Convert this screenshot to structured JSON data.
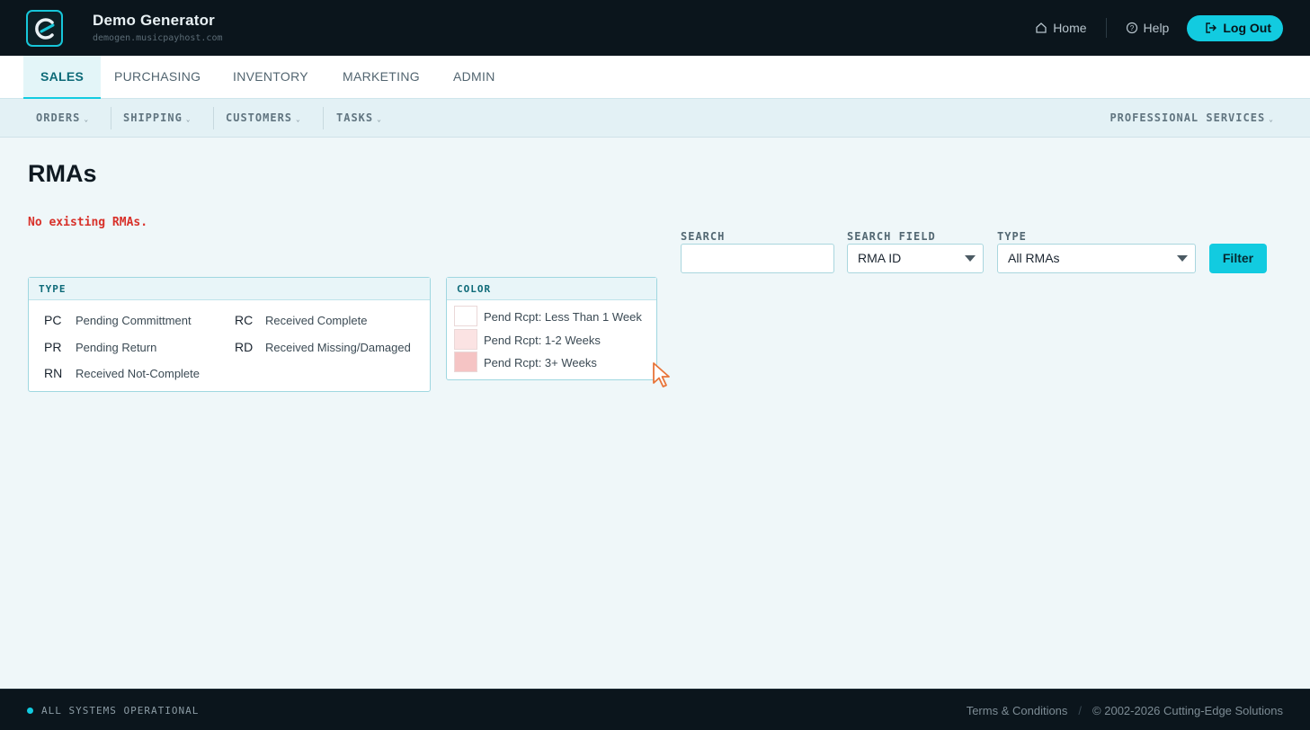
{
  "header": {
    "brand_title": "Demo Generator",
    "brand_subtitle": "demogen.musicpayhost.com",
    "home_label": "Home",
    "help_label": "Help",
    "logout_label": "Log Out"
  },
  "main_nav": {
    "tabs": [
      {
        "label": "SALES",
        "active": true
      },
      {
        "label": "PURCHASING",
        "active": false
      },
      {
        "label": "INVENTORY",
        "active": false
      },
      {
        "label": "MARKETING",
        "active": false
      },
      {
        "label": "ADMIN",
        "active": false
      }
    ]
  },
  "sub_nav": {
    "items": [
      {
        "label": "ORDERS"
      },
      {
        "label": "SHIPPING"
      },
      {
        "label": "CUSTOMERS"
      },
      {
        "label": "TASKS"
      }
    ],
    "right_item": {
      "label": "PROFESSIONAL SERVICES"
    }
  },
  "page": {
    "title": "RMAs",
    "notice": "No existing RMAs."
  },
  "type_legend": {
    "heading": "TYPE",
    "entries": [
      {
        "code": "PC",
        "label": "Pending Committment"
      },
      {
        "code": "RC",
        "label": "Received Complete"
      },
      {
        "code": "PR",
        "label": "Pending Return"
      },
      {
        "code": "RD",
        "label": "Received Missing/Damaged"
      },
      {
        "code": "RN",
        "label": "Received Not-Complete"
      }
    ]
  },
  "color_legend": {
    "heading": "COLOR",
    "entries": [
      {
        "label": "Pend Rcpt: Less Than 1 Week",
        "color": "#ffffff"
      },
      {
        "label": "Pend Rcpt: 1-2 Weeks",
        "color": "#fbe3e3"
      },
      {
        "label": "Pend Rcpt: 3+ Weeks",
        "color": "#f5c4c4"
      }
    ]
  },
  "filters": {
    "search_label": "SEARCH",
    "search_value": "",
    "search_field_label": "SEARCH FIELD",
    "search_field_value": "RMA ID",
    "type_label": "TYPE",
    "type_value": "All RMAs",
    "filter_button": "Filter"
  },
  "footer": {
    "status": "ALL SYSTEMS OPERATIONAL",
    "terms": "Terms & Conditions",
    "separator": "/",
    "copyright": "© 2002-2026 Cutting-Edge Solutions"
  },
  "colors": {
    "accent": "#12cbe0",
    "header_bg": "#0b151c",
    "notice_red": "#d8312a"
  }
}
